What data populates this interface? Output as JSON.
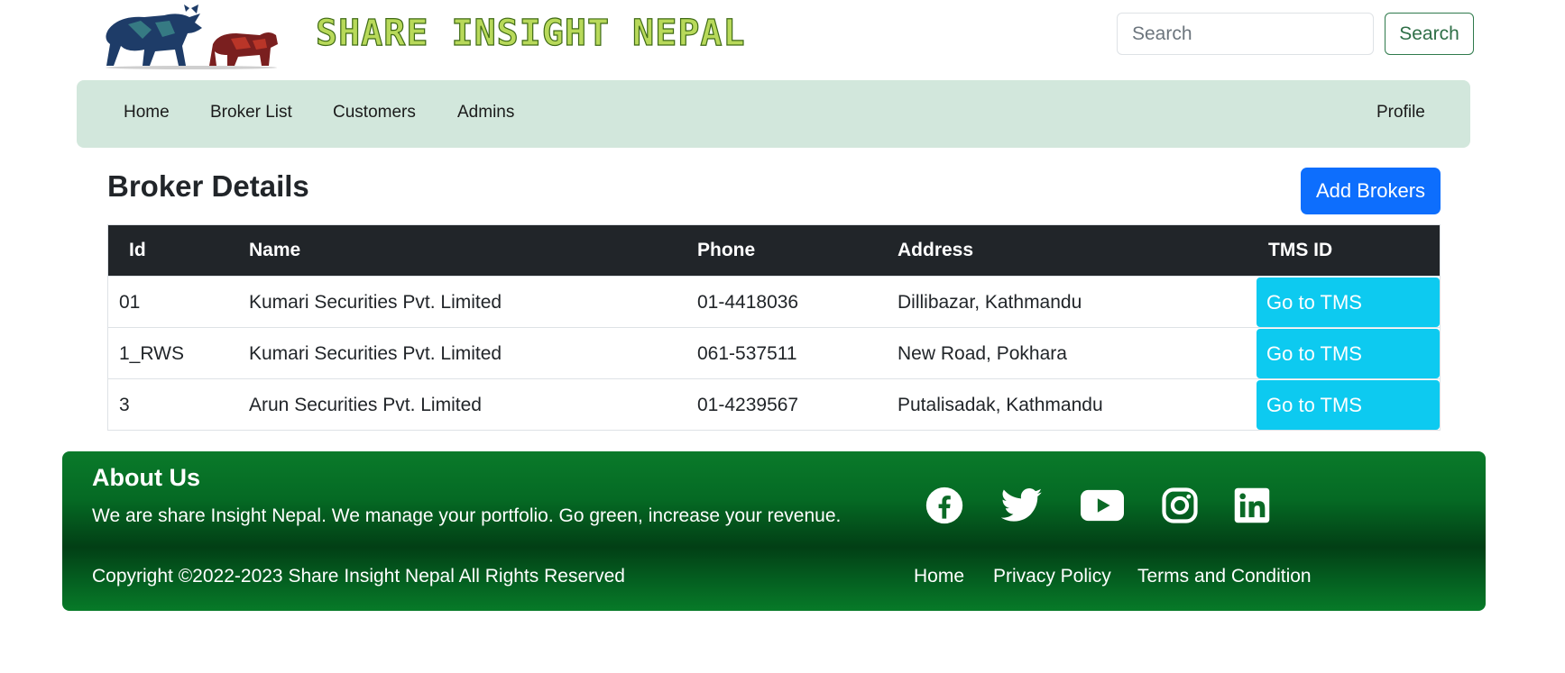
{
  "header": {
    "logo_text": "SHARE INSIGHT NEPAL",
    "search_placeholder": "Search",
    "search_button": "Search"
  },
  "navbar": {
    "items": [
      "Home",
      "Broker List",
      "Customers",
      "Admins"
    ],
    "profile": "Profile"
  },
  "main": {
    "title": "Broker Details",
    "add_button": "Add Brokers",
    "table": {
      "headers": [
        "Id",
        "Name",
        "Phone",
        "Address",
        "TMS ID"
      ],
      "rows": [
        {
          "id": "01",
          "name": "Kumari Securities Pvt. Limited",
          "phone": "01-4418036",
          "address": "Dillibazar, Kathmandu",
          "tms": "Go to TMS"
        },
        {
          "id": "1_RWS",
          "name": "Kumari Securities Pvt. Limited",
          "phone": "061-537511",
          "address": "New Road, Pokhara",
          "tms": "Go to TMS"
        },
        {
          "id": "3",
          "name": "Arun Securities Pvt. Limited",
          "phone": "01-4239567",
          "address": "Putalisadak, Kathmandu",
          "tms": "Go to TMS"
        }
      ]
    }
  },
  "footer": {
    "about_title": "About Us",
    "about_text": "We are share Insight Nepal. We manage your portfolio. Go green, increase your revenue.",
    "copyright": "Copyright ©2022-2023 Share Insight Nepal All Rights Reserved",
    "social_icons": [
      "facebook-icon",
      "twitter-icon",
      "youtube-icon",
      "instagram-icon",
      "linkedin-icon"
    ],
    "links": [
      "Home",
      "Privacy Policy",
      "Terms and Condition"
    ]
  },
  "colors": {
    "navbar_bg": "#d2e7dc",
    "primary": "#0d6efd",
    "info": "#0dcaf0",
    "table_header": "#212529",
    "footer_green": "#0a7a2a",
    "search_outline": "#2f7a4c"
  }
}
